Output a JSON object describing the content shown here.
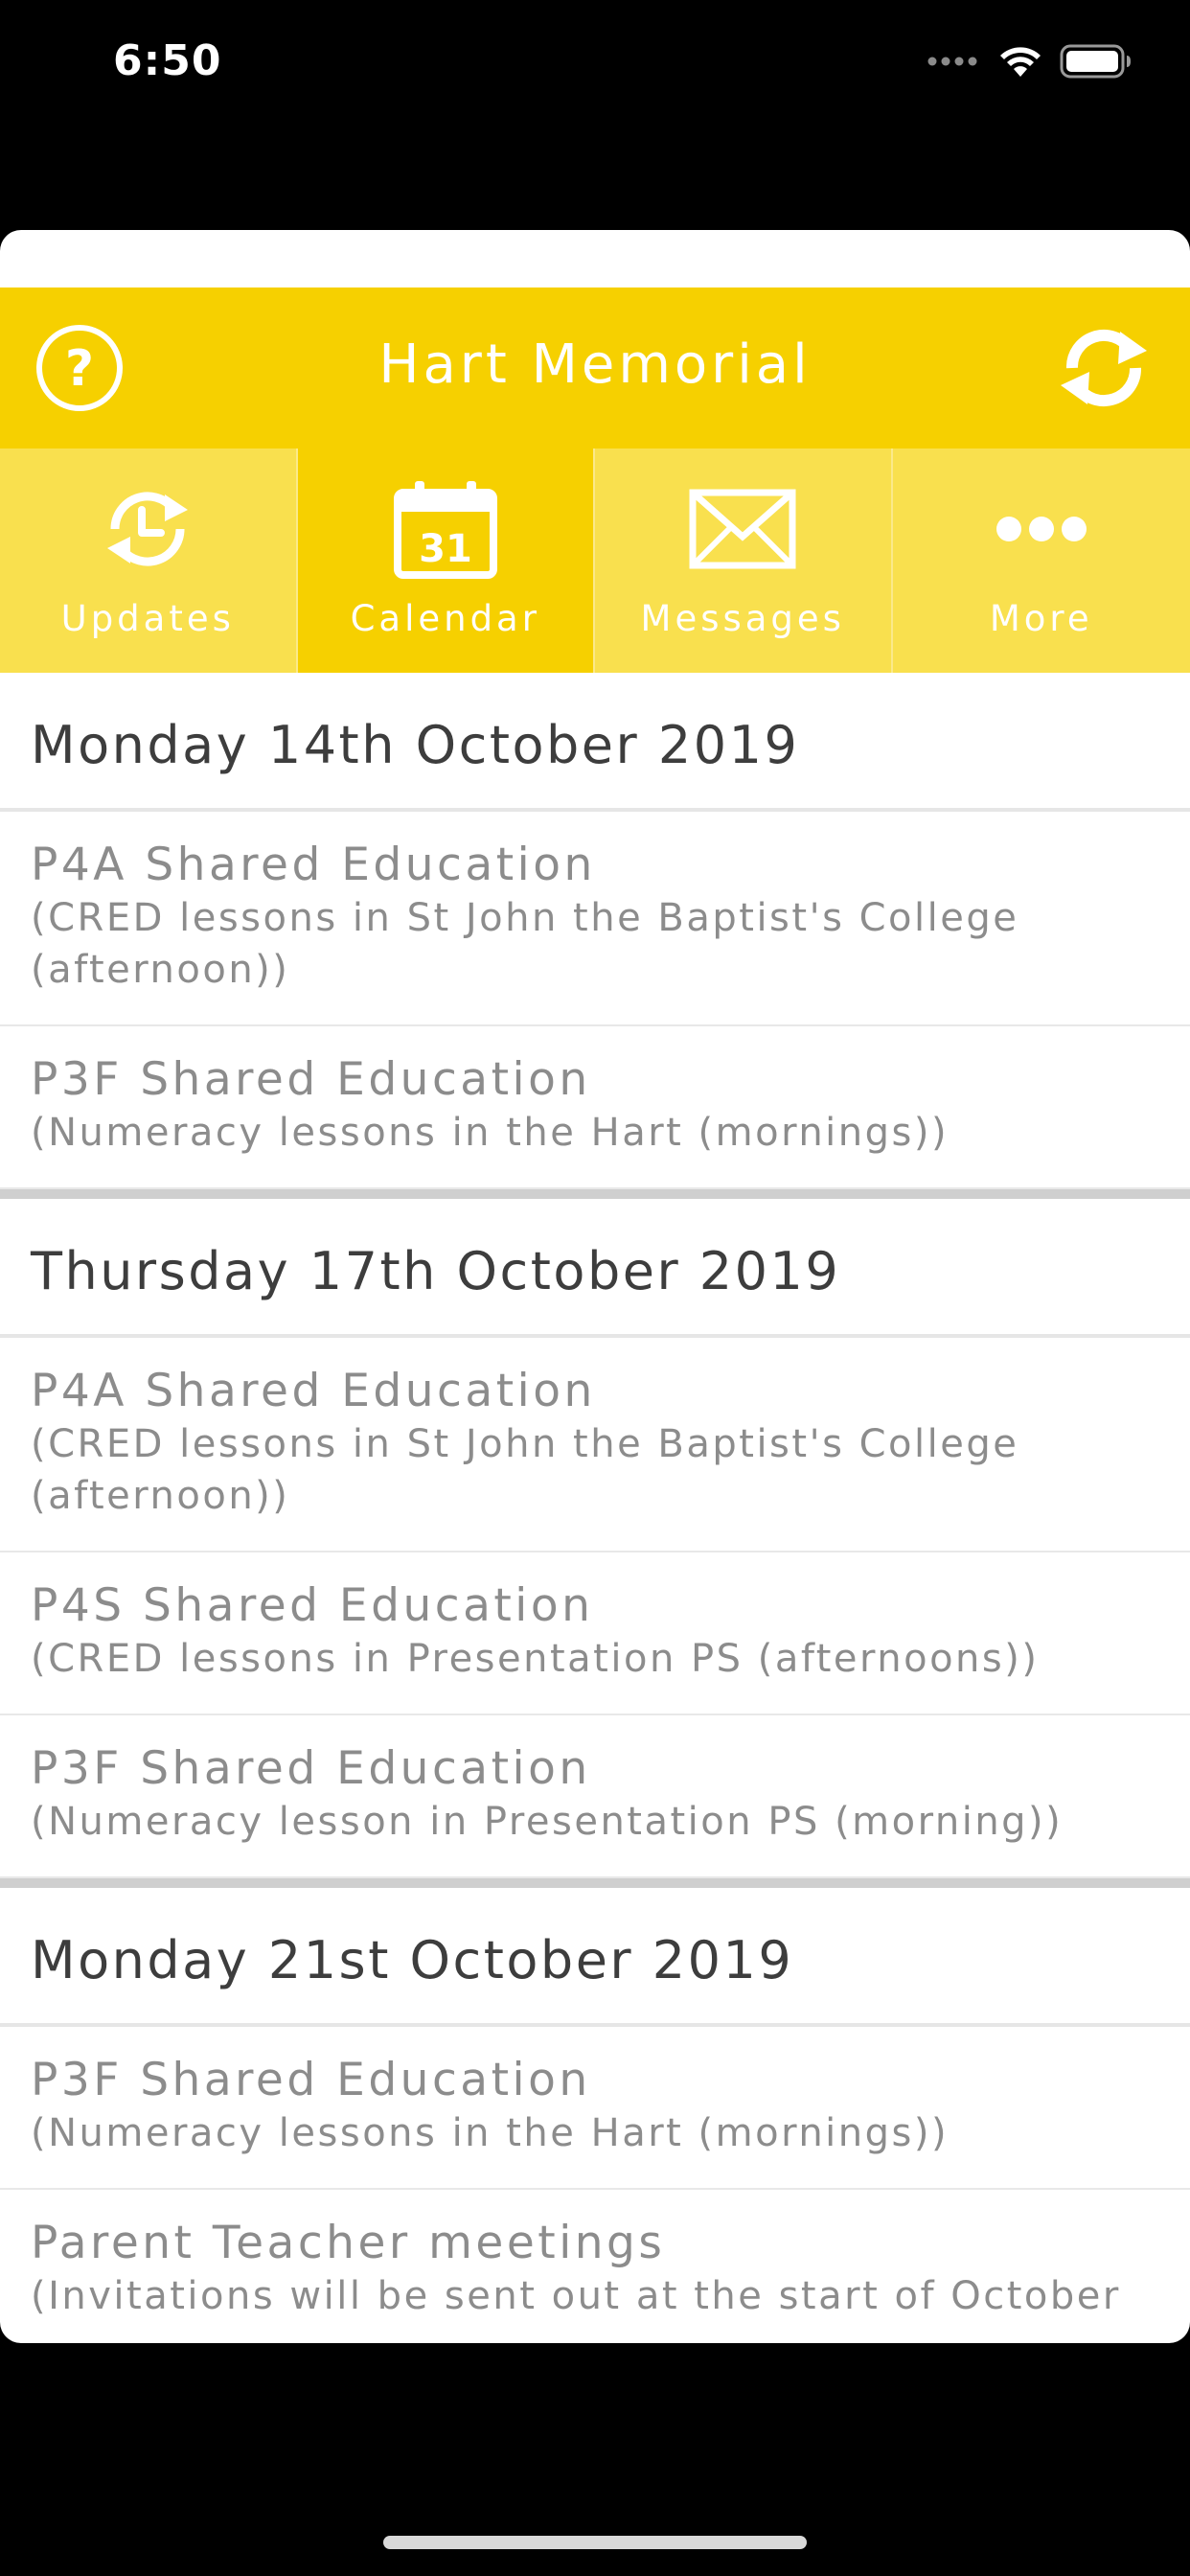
{
  "status_bar": {
    "time": "6:50"
  },
  "header": {
    "title": "Hart Memorial",
    "help_icon": "question-circle-icon",
    "refresh_icon": "refresh-icon",
    "accent_color": "#f6d000"
  },
  "tabs": [
    {
      "label": "Updates",
      "icon": "clock-refresh-icon",
      "active": false
    },
    {
      "label": "Calendar",
      "icon": "calendar-icon",
      "active": true,
      "icon_text": "31"
    },
    {
      "label": "Messages",
      "icon": "envelope-icon",
      "active": false
    },
    {
      "label": "More",
      "icon": "more-dots-icon",
      "active": false
    }
  ],
  "days": [
    {
      "date": "Monday 14th October 2019",
      "events": [
        {
          "title": "P4A Shared Education",
          "desc": "(CRED lessons in St John the Baptist's College (afternoon))"
        },
        {
          "title": "P3F Shared Education",
          "desc": "(Numeracy lessons in the Hart (mornings))"
        }
      ]
    },
    {
      "date": "Thursday 17th October 2019",
      "events": [
        {
          "title": "P4A Shared Education",
          "desc": "(CRED lessons in St John the Baptist's College (afternoon))"
        },
        {
          "title": "P4S Shared Education",
          "desc": "(CRED lessons in Presentation PS (afternoons))"
        },
        {
          "title": "P3F Shared Education",
          "desc": "(Numeracy lesson in Presentation PS (morning))"
        }
      ]
    },
    {
      "date": "Monday 21st October 2019",
      "events": [
        {
          "title": "P3F Shared Education",
          "desc": "(Numeracy lessons in the Hart (mornings))"
        },
        {
          "title": "Parent Teacher meetings",
          "desc": "(Invitations will be sent out at the start of October"
        }
      ]
    }
  ]
}
